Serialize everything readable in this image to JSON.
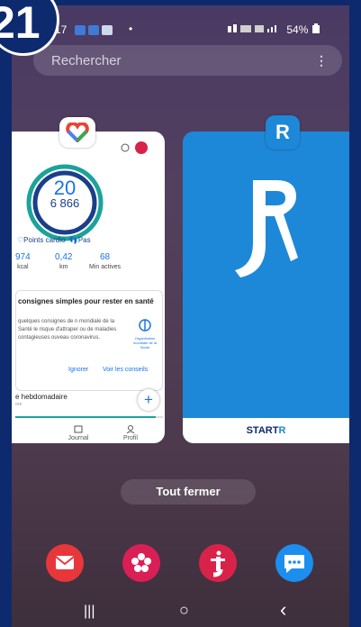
{
  "step_badge": "21",
  "statusbar": {
    "time": "17",
    "dot": "•",
    "right": "54%"
  },
  "search": {
    "placeholder": "Rechercher",
    "more": "⋮"
  },
  "health_card": {
    "ring_points": "20",
    "ring_steps": "6 866",
    "legend_points": "Points cardio",
    "legend_steps": "Pas",
    "stats": [
      {
        "value": "974",
        "unit": "kcal"
      },
      {
        "value": "0,42",
        "unit": "km"
      },
      {
        "value": "68",
        "unit": "Min actives"
      }
    ],
    "info_title": "consignes simples pour rester en santé",
    "info_body": "quelques consignes de n mondiale de la Santé le risque d'attraper ou de maladies contagieuses ouveau coronavirus.",
    "who_label": "Organisation mondiale de la Santé",
    "ignore_button": "Ignorer",
    "see_button": "Voir les conseils",
    "weekly_title": "e hebdomadaire",
    "weekly_sub": "ore",
    "weekly_progress": 0.95,
    "plus": "+",
    "nav_journal": "Journal",
    "nav_profil": "Profil"
  },
  "startr_card": {
    "icon_letter": "R",
    "brand_prefix": "START",
    "brand_suffix": "R"
  },
  "close_all": "Tout fermer",
  "dock": [
    {
      "name": "email-app-icon",
      "color": "#e8373b"
    },
    {
      "name": "flower-app-icon",
      "color": "#d91f55"
    },
    {
      "name": "jaime-app-icon",
      "color": "#d9224a"
    },
    {
      "name": "messages-app-icon",
      "color": "#1c8ef0"
    }
  ],
  "navbar": {
    "recents": "|||",
    "home": "○",
    "back": "‹"
  },
  "colors": {
    "badge": "#0d2a6e",
    "startr_blue": "#1e88d8",
    "fit_blue": "#1a73e8",
    "fit_teal": "#1aa39a"
  }
}
